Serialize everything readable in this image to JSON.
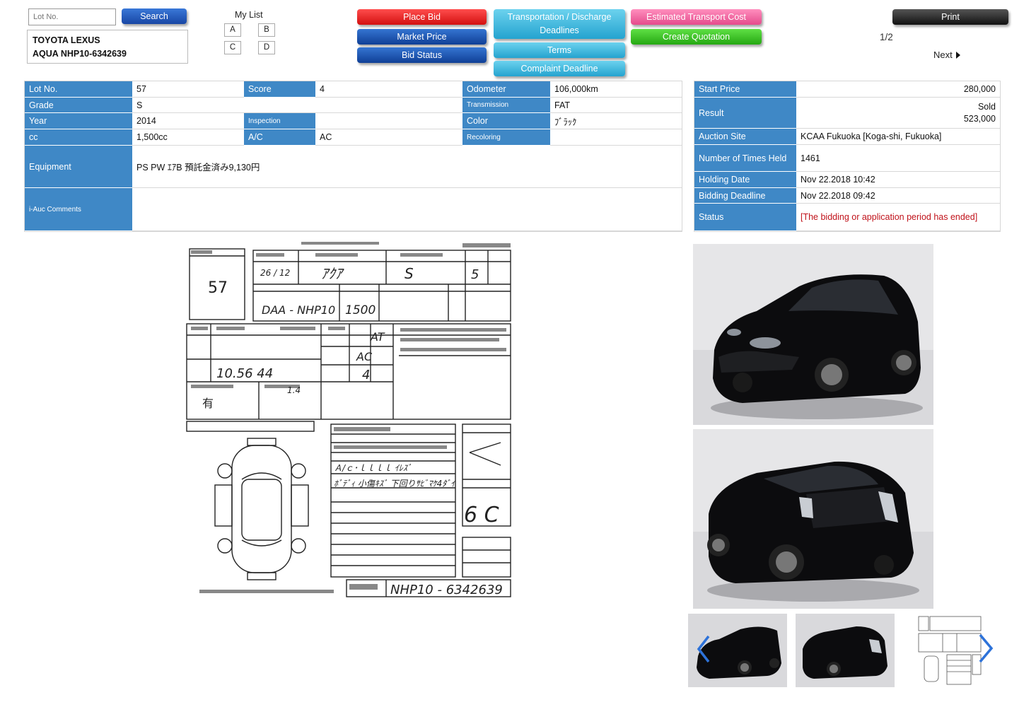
{
  "search": {
    "placeholder": "Lot No.",
    "button_label": "Search"
  },
  "vehicle": {
    "line1": "TOYOTA LEXUS",
    "line2": "AQUA NHP10-6342639"
  },
  "my_list": {
    "title": "My List",
    "items": [
      "A",
      "B",
      "C",
      "D"
    ]
  },
  "actions": {
    "place_bid": "Place Bid",
    "market_price": "Market Price",
    "bid_status": "Bid Status",
    "transport_deadlines": "Transportation / Discharge Deadlines",
    "terms": "Terms",
    "complaint_deadline": "Complaint Deadline",
    "estimated_transport_cost": "Estimated Transport Cost",
    "create_quotation": "Create Quotation",
    "print": "Print"
  },
  "pager": {
    "count": "1/2",
    "next_label": "Next"
  },
  "details": {
    "lot_no_label": "Lot No.",
    "lot_no": "57",
    "score_label": "Score",
    "score": "4",
    "grade_label": "Grade",
    "grade": "S",
    "year_label": "Year",
    "year": "2014",
    "inspection_label": "Inspection",
    "inspection": "",
    "cc_label": "cc",
    "cc": "1,500cc",
    "ac_label": "A/C",
    "ac": "AC",
    "odometer_label": "Odometer",
    "odometer": "106,000km",
    "transmission_label": "Transmission",
    "transmission": "FAT",
    "color_label": "Color",
    "color": "ﾌﾞﾗｯｸ",
    "recoloring_label": "Recoloring",
    "recoloring": "",
    "equipment_label": "Equipment",
    "equipment": "PS PW ｴｱB 預託金済み9,130円",
    "comments_label": "i-Auc Comments",
    "comments": ""
  },
  "auction": {
    "start_price_label": "Start Price",
    "start_price": "280,000",
    "result_label": "Result",
    "result_status": "Sold",
    "result_price": "523,000",
    "site_label": "Auction Site",
    "site": "KCAA Fukuoka [Koga-shi, Fukuoka]",
    "times_label": "Number of Times Held",
    "times": "1461",
    "holding_label": "Holding Date",
    "holding": "Nov 22.2018 10:42",
    "deadline_label": "Bidding Deadline",
    "deadline": "Nov 22.2018 09:42",
    "status_label": "Status",
    "status": "[The bidding or application period has ended]"
  },
  "sheet": {
    "lot": "57",
    "year_hand": "26 / 12",
    "model_hand": "ｱｸｱ",
    "grade_hand": "S",
    "doors_hand": "5",
    "type_hand": "DAA - NHP10",
    "cc_hand": "1500",
    "odo_hand": "10.56 44",
    "shift_hand": "AT",
    "ac_hand": "AC",
    "score_hand": "4",
    "interior_hand": "6 C",
    "chassis_hand": "NHP10 - 6342639",
    "remark1": "有",
    "remark2": "1.4",
    "note1": "Ａ/ｃ･ｌｌｌｌ ｲﾚｽﾞ",
    "note2": "ﾎﾞﾃﾞｨ 小傷ｷｽﾞ 下回りｻﾋﾞﾏｹ4ﾀﾞｲ"
  },
  "colors": {
    "label_bg": "#3f88c6",
    "status_red": "#c0121a",
    "car_body": "#0c0c0e",
    "studio_bg": "#d9d9dc"
  }
}
